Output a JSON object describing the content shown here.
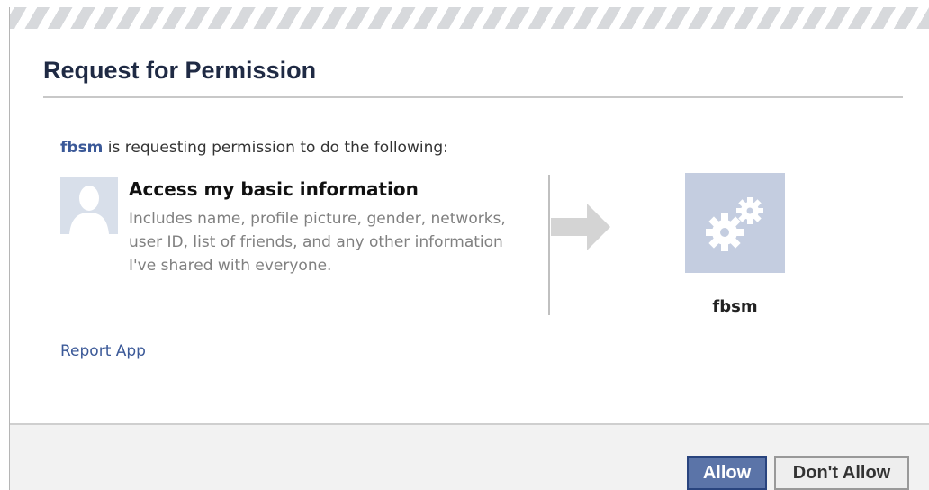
{
  "dialog": {
    "title": "Request for Permission"
  },
  "intro": {
    "app_link": "fbsm",
    "text": " is requesting permission to do the following:"
  },
  "permission": {
    "title": "Access my basic information",
    "description": "Includes name, profile picture, gender, networks, user ID, list of friends, and any other information I've shared with everyone.",
    "avatar_icon": "default-profile-silhouette-icon",
    "arrow_icon": "arrow-right-icon"
  },
  "app": {
    "name": "fbsm",
    "icon": "gears-icon"
  },
  "links": {
    "report": "Report App"
  },
  "buttons": {
    "allow": "Allow",
    "deny": "Don't Allow"
  },
  "colors": {
    "link": "#3b5998",
    "allow_button": "#5b74a8",
    "app_icon_bg": "#c4cde0"
  }
}
